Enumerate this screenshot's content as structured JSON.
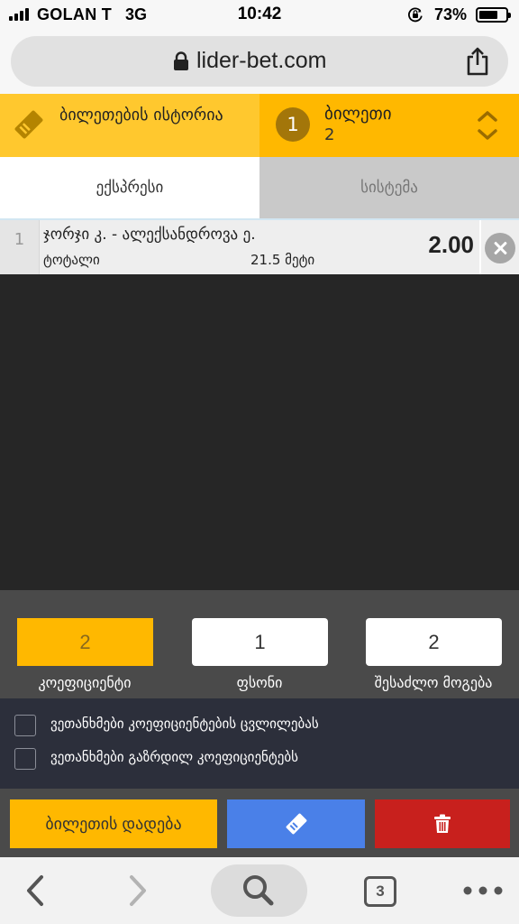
{
  "status_bar": {
    "carrier": "GOLAN T",
    "network": "3G",
    "time": "10:42",
    "battery_percent": "73%",
    "battery_level": 0.73
  },
  "browser": {
    "url": "lider-bet.com",
    "open_tabs": "3"
  },
  "ticket_header": {
    "history_label": "ბილეთების ისტორია",
    "ticket_badge": "1",
    "ticket_label": "ბილეთი",
    "ticket_number": "2"
  },
  "mode_tabs": {
    "express": "ექსპრესი",
    "system": "სისტემა"
  },
  "bets": [
    {
      "index": "1",
      "event": "ჯორჯი კ. - ალექსანდროვა ე.",
      "market": "ტოტალი",
      "outcome": "21.5 მეტი",
      "odd": "2.00"
    }
  ],
  "summary": {
    "coefficient_value": "2",
    "coefficient_label": "კოეფიციენტი",
    "stake_value": "1",
    "stake_label": "ფსონი",
    "win_value": "2",
    "win_label": "შესაძლო მოგება"
  },
  "checkboxes": [
    {
      "label": "ვეთანხმები კოეფიციენტების ცვლილებას",
      "checked": false
    },
    {
      "label": "ვეთანხმები გაზრდილ კოეფიციენტებს",
      "checked": false
    }
  ],
  "actions": {
    "place_bet": "ბილეთის დადება"
  },
  "icons": {
    "history": "ticket-icon",
    "save": "ticket-icon",
    "delete": "trash-icon",
    "remove_bet": "close-circle-icon"
  },
  "colors": {
    "accent_yellow": "#ffb800",
    "save_blue": "#4a80e8",
    "delete_red": "#c8201d"
  }
}
